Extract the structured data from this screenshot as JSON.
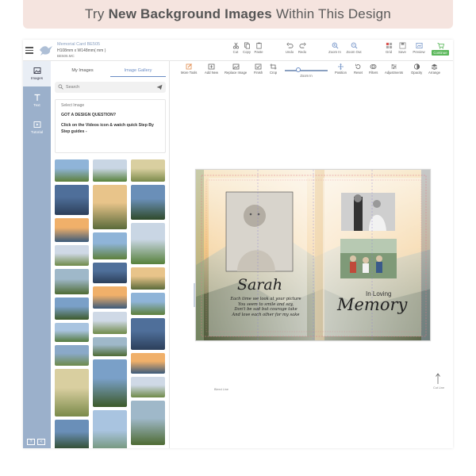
{
  "banner": {
    "prefix": "Try",
    "highlight": "New Background Images",
    "suffix": "Within This Design"
  },
  "header": {
    "doc_title": "Memorial Card BE505",
    "doc_size": "H108mm x W148mm( mm )",
    "doc_code": "BE505.MC",
    "tools": [
      "Cut",
      "Copy",
      "Paste",
      "Undo",
      "Redo",
      "Zoom In",
      "Zoom Out",
      "Grid",
      "Save",
      "Preview",
      "Continue"
    ]
  },
  "rail": {
    "items": [
      "Images",
      "Text",
      "Tutorial"
    ],
    "bottom": [
      "?",
      "<"
    ]
  },
  "panel": {
    "tabs": [
      "My Images",
      "Image Gallery"
    ],
    "search_placeholder": "Search",
    "select_label": "Select Image",
    "question": "GOT A DESIGN QUESTION?",
    "hint": "Click on the Videos icon & watch quick Step By Step guides -"
  },
  "toolbar": {
    "tools": [
      "More Tools",
      "Add New",
      "Replace Image",
      "Finish",
      "Crop",
      "Position",
      "Reset",
      "Filters",
      "Adjustments",
      "Opacity",
      "Arrange"
    ],
    "zoom_label": "Zoom In",
    "zoom_level": 0.3
  },
  "card": {
    "name": "Sarah",
    "in_loving": "In Loving",
    "memory": "Memory",
    "poem": [
      "Each time we look at your picture",
      "You seem to smile and say,",
      "Don't be sad but courage take",
      "And love each other for my sake"
    ],
    "left_caption": "Bleed Line",
    "right_caption": "Cut Line"
  },
  "colors": {
    "rail": "#9bb0cb",
    "accent": "#6a8cc4",
    "banner": "#f5e4df",
    "continue": "#5cb85c"
  }
}
